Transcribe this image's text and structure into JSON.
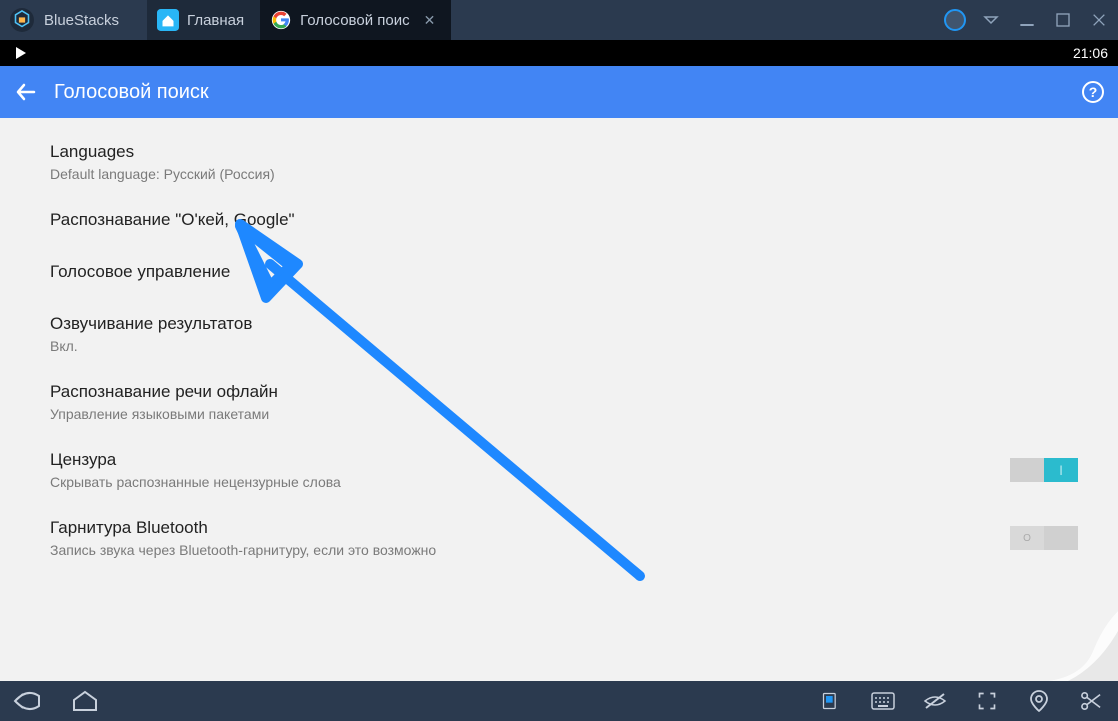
{
  "titlebar": {
    "app_name": "BlueStacks",
    "tabs": [
      {
        "label": "Главная"
      },
      {
        "label": "Голосовой поис"
      }
    ]
  },
  "statusbar": {
    "time": "21:06"
  },
  "header": {
    "title": "Голосовой поиск",
    "help": "?"
  },
  "settings": [
    {
      "title": "Languages",
      "sub": "Default language: Русский (Россия)",
      "toggle": null
    },
    {
      "title": "Распознавание \"О'кей, Google\"",
      "sub": "",
      "toggle": null
    },
    {
      "title": "Голосовое управление",
      "sub": "",
      "toggle": null
    },
    {
      "title": "Озвучивание результатов",
      "sub": "Вкл.",
      "toggle": null
    },
    {
      "title": "Распознавание речи офлайн",
      "sub": "Управление языковыми пакетами",
      "toggle": null
    },
    {
      "title": "Цензура",
      "sub": "Скрывать распознанные нецензурные слова",
      "toggle": "on"
    },
    {
      "title": "Гарнитура Bluetooth",
      "sub": "Запись звука через Bluetooth-гарнитуру, если это возможно",
      "toggle": "off"
    }
  ]
}
